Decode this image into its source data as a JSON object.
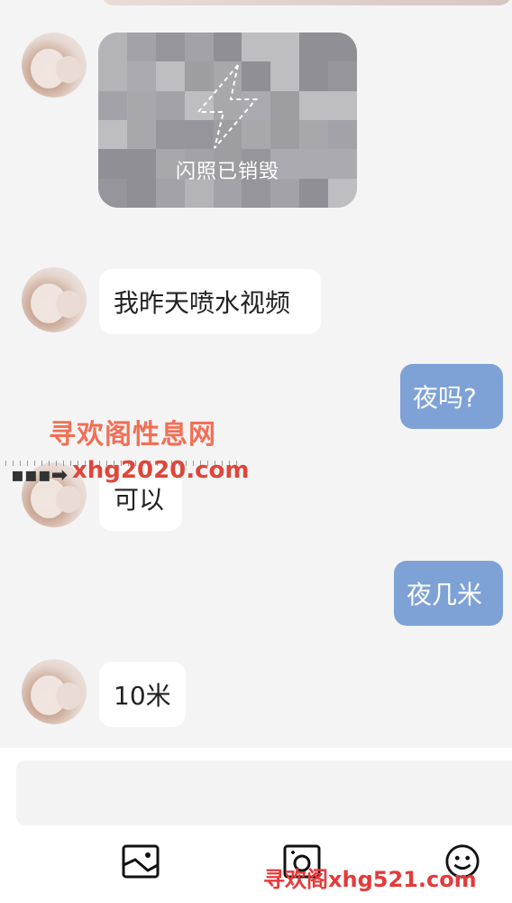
{
  "messages": [
    {
      "side": "left",
      "type": "flash-photo",
      "text": "闪照已销毁"
    },
    {
      "side": "left",
      "type": "text",
      "text": "我昨天喷水视频"
    },
    {
      "side": "right",
      "type": "text",
      "text": "夜吗?"
    },
    {
      "side": "left",
      "type": "text",
      "text": "可以"
    },
    {
      "side": "right",
      "type": "text",
      "text": "夜几米"
    },
    {
      "side": "left",
      "type": "text",
      "text": "10米"
    }
  ],
  "watermark": {
    "site_name": "寻欢阁性息网",
    "url": "xhg2020.com",
    "bottom_name": "寻欢阁",
    "bottom_url": "xhg521.com"
  },
  "toolbar": {
    "icons": [
      "image-icon",
      "camera-icon",
      "emoji-icon"
    ]
  },
  "colors": {
    "outgoing_bubble": "#7ea2d6",
    "incoming_bubble": "#ffffff",
    "background": "#f4f4f5"
  }
}
